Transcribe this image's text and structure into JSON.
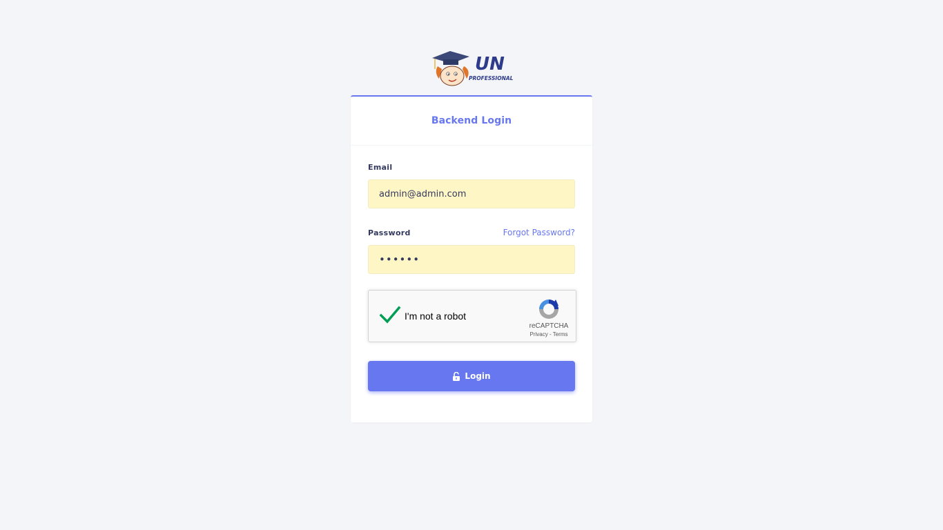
{
  "logo": {
    "text": "UN",
    "subtext": "PROFESSIONAL",
    "icon": "graduate-mascot-icon"
  },
  "card": {
    "title": "Backend Login"
  },
  "form": {
    "email_label": "Email",
    "email_value": "admin@admin.com",
    "password_label": "Password",
    "forgot_password": "Forgot Password?",
    "password_value": "••••••",
    "login_label": "Login",
    "login_icon": "unlock-icon"
  },
  "recaptcha": {
    "label": "I'm not a robot",
    "brand": "reCAPTCHA",
    "privacy": "Privacy",
    "separator": " - ",
    "terms": "Terms",
    "checked": true
  },
  "colors": {
    "accent": "#6777ef",
    "page_bg": "#f4f5f9",
    "input_bg": "#fef6c4",
    "check_green": "#009e55"
  }
}
